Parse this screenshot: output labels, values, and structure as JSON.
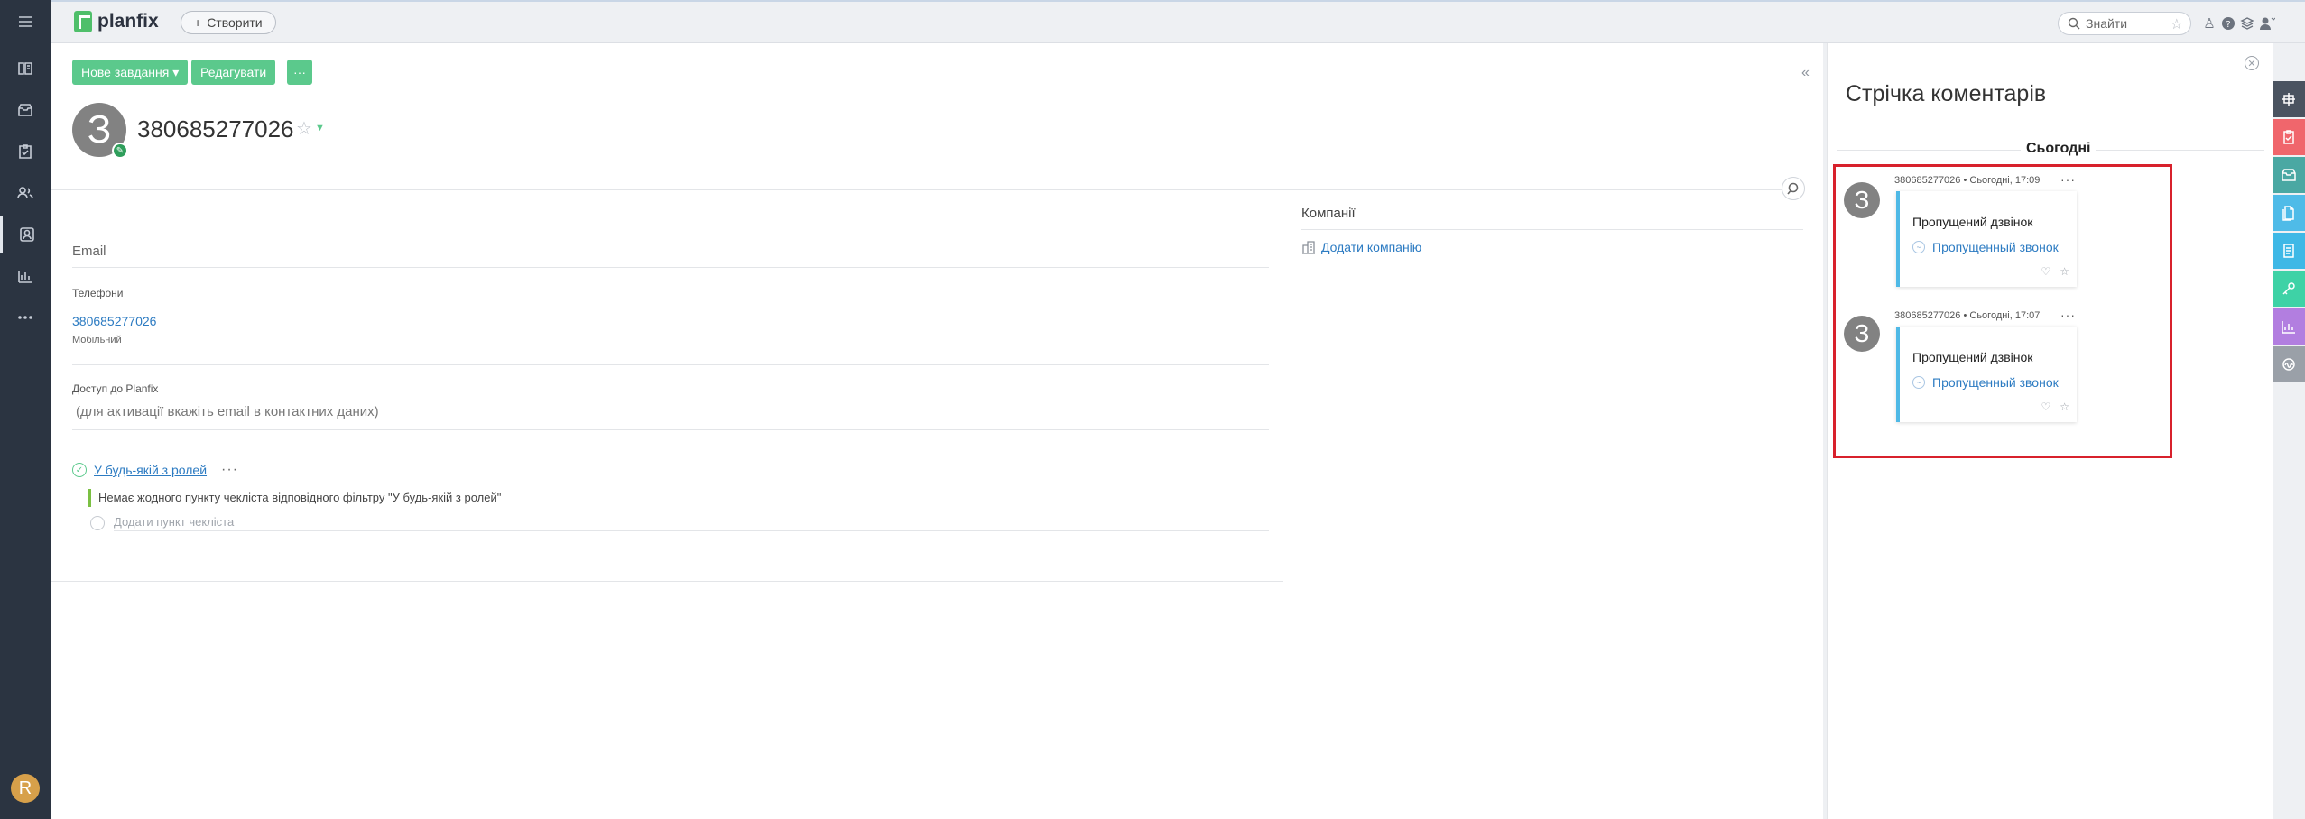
{
  "app": {
    "logo_text": "planfix"
  },
  "topbar": {
    "create_label": "Створити",
    "search_placeholder": "Знайти"
  },
  "toolbar": {
    "new_task_label": "Нове завдання ▾",
    "edit_label": "Редагувати",
    "more_label": "···"
  },
  "contact": {
    "avatar_letter": "З",
    "name": "380685277026"
  },
  "fields": {
    "email_label": "Email",
    "phones_label": "Телефони",
    "phone_value": "380685277026",
    "phone_type": "Мобільний",
    "access_label": "Доступ до Planfix",
    "access_hint": "(для активації вкажіть email в контактних даних)"
  },
  "checklist": {
    "link_label": "У будь-якій з ролей",
    "more_label": "···",
    "empty_note": "Немає жодного пункту чекліста відповідного фільтру \"У будь-якій з ролей\"",
    "add_item_placeholder": "Додати пункт чекліста"
  },
  "companies": {
    "title": "Компанії",
    "add_label": "Додати компанію"
  },
  "comments": {
    "title": "Стрічка коментарів",
    "day_label": "Сьогодні",
    "items": [
      {
        "avatar_letter": "З",
        "meta": "380685277026 • Сьогодні, 17:09",
        "title": "Пропущений дзвінок",
        "link": "Пропущенный звонок"
      },
      {
        "avatar_letter": "З",
        "meta": "380685277026 • Сьогодні, 17:07",
        "title": "Пропущений дзвінок",
        "link": "Пропущенный звонок"
      }
    ]
  },
  "user": {
    "avatar_letter": "R"
  },
  "colors": {
    "nav_bg": "#2b3441",
    "accent_green": "#5bc98c",
    "link_blue": "#2c7bc2",
    "highlight_red": "#d8212c",
    "strip_colors": [
      "#4a5360",
      "#f0666c",
      "#4aa8a3",
      "#4fbbe8",
      "#3eb8e6",
      "#3ed2a6",
      "#b27ee0",
      "#9aa0a8"
    ]
  }
}
